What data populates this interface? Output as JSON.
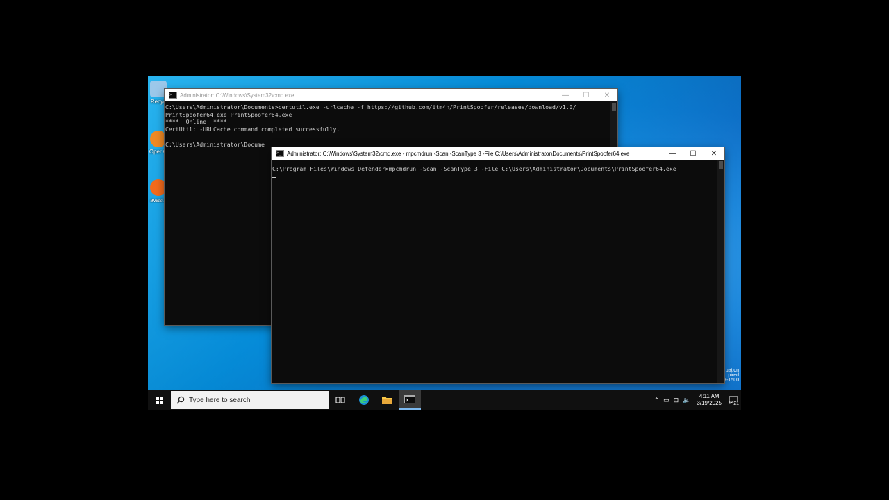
{
  "desktop_icons": [
    {
      "name": "recycle-bin",
      "label": "Recyc",
      "color": "#9cc8ea"
    },
    {
      "name": "open-gl",
      "label": "Oper G",
      "color": "#f08a24"
    },
    {
      "name": "avast",
      "label": "avast_",
      "color": "#f36b1c"
    }
  ],
  "back_window": {
    "title": "Administrator: C:\\Windows\\System32\\cmd.exe",
    "lines": [
      "C:\\Users\\Administrator\\Documents>certutil.exe -urlcache -f https://github.com/itm4n/PrintSpoofer/releases/download/v1.0/",
      "PrintSpoofer64.exe PrintSpoofer64.exe",
      "****  Online  ****",
      "CertUtil: -URLCache command completed successfully.",
      "",
      "C:\\Users\\Administrator\\Docume"
    ]
  },
  "front_window": {
    "title": "Administrator: C:\\Windows\\System32\\cmd.exe - mpcmdrun  -Scan -ScanType 3 -File C:\\Users\\Administrator\\Documents\\PrintSpoofer64.exe",
    "lines": [
      "",
      "C:\\Program Files\\Windows Defender>mpcmdrun -Scan -ScanType 3 -File C:\\Users\\Administrator\\Documents\\PrintSpoofer64.exe"
    ]
  },
  "window_controls": {
    "minimize": "—",
    "maximize": "☐",
    "close": "✕"
  },
  "watermark": {
    "line1": "uation",
    "line2": "pired",
    "build": "Build 20348.fe_release.210507-1500"
  },
  "taskbar": {
    "search_placeholder": "Type here to search",
    "clock_time": "4:11 AM",
    "clock_date": "3/19/2025",
    "notification_count": "21",
    "tray_icons": [
      "chevron-up-icon",
      "battery-icon",
      "network-icon",
      "speaker-muted-icon"
    ]
  },
  "colors": {
    "terminal_bg": "#0c0c0c",
    "terminal_fg": "#cccccc",
    "taskbar_bg": "#101010",
    "accent": "#7db9ef"
  }
}
